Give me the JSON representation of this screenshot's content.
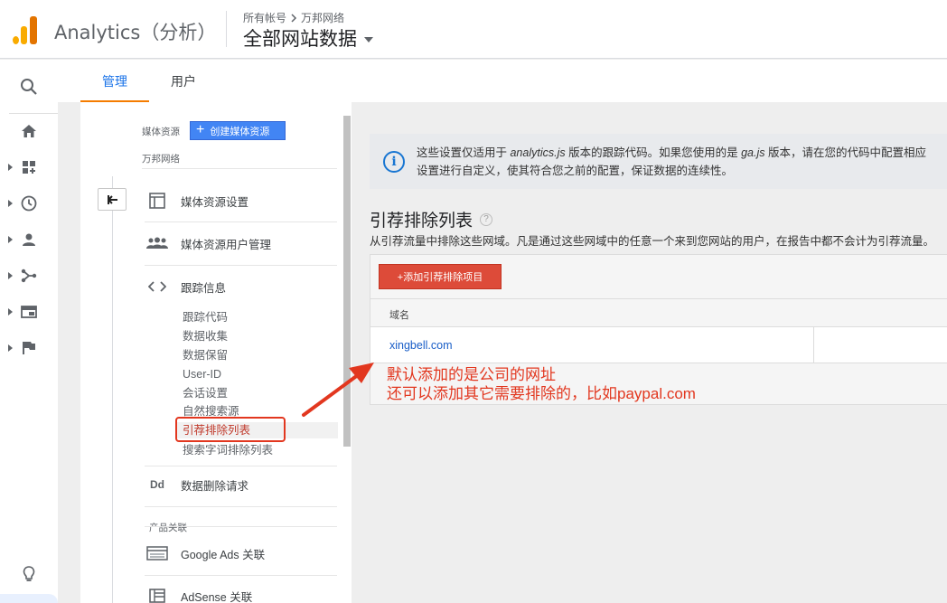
{
  "header": {
    "app_title": "Analytics（分析）",
    "breadcrumb_account": "所有帐号",
    "breadcrumb_property": "万邦网络",
    "view_name": "全部网站数据"
  },
  "tabs": [
    {
      "label": "管理",
      "active": true
    },
    {
      "label": "用户",
      "active": false
    }
  ],
  "rail": {
    "icons": [
      "search-icon",
      "home-icon",
      "customization-icon",
      "realtime-icon",
      "audience-icon",
      "acquisition-icon",
      "behavior-icon",
      "conversions-icon",
      "lightbulb-icon"
    ]
  },
  "nav": {
    "section_label": "媒体资源",
    "create_button": "创建媒体资源",
    "property_name": "万邦网络",
    "items": [
      {
        "label": "媒体资源设置",
        "icon": "property-settings-icon"
      },
      {
        "label": "媒体资源用户管理",
        "icon": "users-icon"
      },
      {
        "label": "跟踪信息",
        "icon": "code-icon"
      }
    ],
    "sub_items": [
      "跟踪代码",
      "数据收集",
      "数据保留",
      "User-ID",
      "会话设置",
      "自然搜索源",
      "引荐排除列表",
      "搜索字词排除列表"
    ],
    "delete_request": {
      "label": "数据删除请求",
      "icon_text": "Dd"
    },
    "product_link_label": "产品关联",
    "product_links": [
      {
        "label": "Google Ads 关联",
        "icon": "google-ads-icon"
      },
      {
        "label": "AdSense 关联",
        "icon": "adsense-icon"
      }
    ]
  },
  "main": {
    "info_line1_a": "这些设置仅适用于 ",
    "info_line1_b": "analytics.js",
    "info_line1_c": " 版本的跟踪代码。如果您使用的是 ",
    "info_line1_d": "ga.js",
    "info_line1_e": " 版本，请在您的代码中配置相应",
    "info_line2": "设置进行自定义，使其符合您之前的配置，保证数据的连续性。",
    "title": "引荐排除列表",
    "description": "从引荐流量中排除这些网域。凡是通过这些网域中的任意一个来到您网站的用户，在报告中都不会计为引荐流量。",
    "add_button": "+添加引荐排除项目",
    "column_header": "域名",
    "rows": [
      {
        "domain": "xingbell.com"
      }
    ]
  },
  "annotation": {
    "line1": "默认添加的是公司的网址",
    "line2": "还可以添加其它需要排除的，比如paypal.com",
    "color": "#e2371f"
  }
}
